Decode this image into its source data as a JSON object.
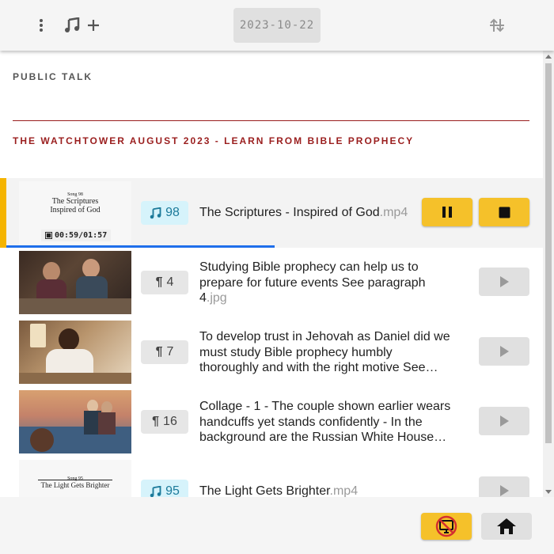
{
  "toolbar": {
    "menu_icon": "more-vertical-icon",
    "music_icon": "music-note-icon",
    "add_icon": "plus-icon",
    "date": "2023-10-22",
    "sort_icon": "sort-arrows-icon"
  },
  "sections": {
    "public_talk": "PUBLIC TALK",
    "watchtower": "THE WATCHTOWER AUGUST 2023 - LEARN FROM BIBLE PROPHECY"
  },
  "items": [
    {
      "type": "song",
      "badge_number": "98",
      "title": "The Scriptures - Inspired of God",
      "ext": ".mp4",
      "thumb_lines": [
        "Song 98",
        "The Scriptures",
        "Inspired of God"
      ],
      "time": "00:59/01:57",
      "progress_fraction": 0.5,
      "state": "playing"
    },
    {
      "type": "paragraph",
      "badge_number": "4",
      "title": "Studying Bible prophecy can help us to prepare for future events See paragraph 4",
      "ext": ".jpg",
      "state": "idle"
    },
    {
      "type": "paragraph",
      "badge_number": "7",
      "title": "To develop trust in Jehovah as Daniel did we must study Bible prophecy humbly thoroughly and with the right motive See…",
      "ext": "",
      "state": "idle"
    },
    {
      "type": "paragraph",
      "badge_number": "16",
      "title": "Collage - 1 -  The couple shown earlier wears handcuffs yet stands confidently - In the background are the Russian White House…",
      "ext": "",
      "state": "idle"
    },
    {
      "type": "song",
      "badge_number": "95",
      "title": "The Light Gets Brighter",
      "ext": ".mp4",
      "thumb_lines": [
        "Song 95",
        "The Light Gets Brighter"
      ],
      "state": "idle"
    }
  ],
  "bottom": {
    "present_icon": "no-presentation-icon",
    "home_icon": "home-icon"
  },
  "colors": {
    "accent_yellow": "#f5c12a",
    "active_bar": "#f5b400",
    "section_red": "#9a1e1e",
    "song_badge_bg": "#d6f3fb",
    "progress_blue": "#1f6feb"
  }
}
